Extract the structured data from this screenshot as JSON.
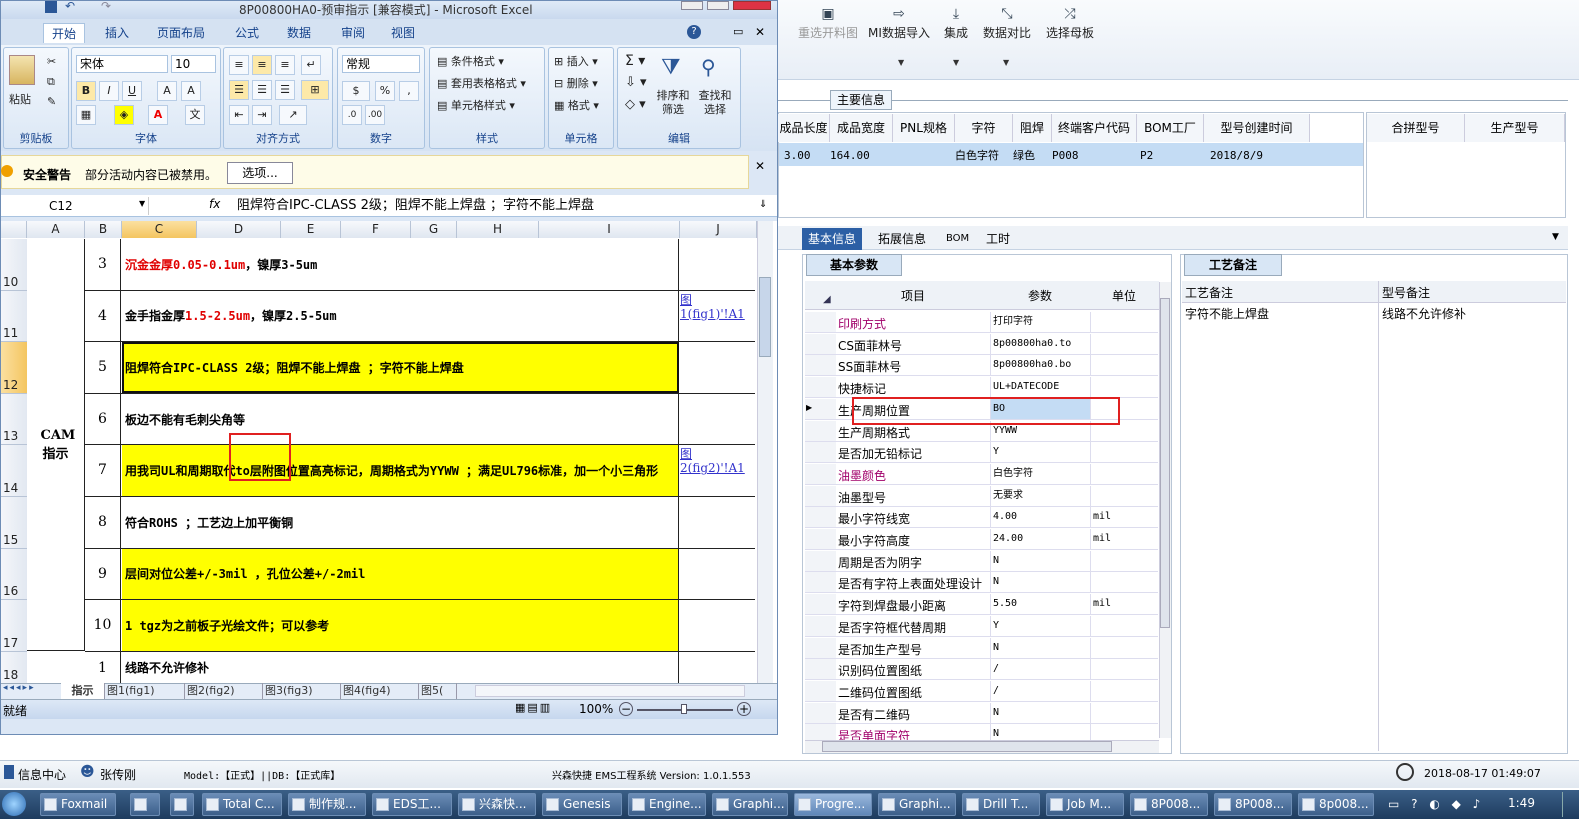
{
  "right_toolbar": [
    {
      "label": "重选开料图",
      "icon": "image-icon"
    },
    {
      "label": "MI数据导入",
      "icon": "import-icon"
    },
    {
      "label": "集成",
      "icon": "download-icon"
    },
    {
      "label": "数据对比",
      "icon": "compare-icon"
    },
    {
      "label": "选择母板",
      "icon": "shuffle-icon"
    }
  ],
  "main_info_tab": "主要信息",
  "grid": {
    "headers": [
      "成品长度",
      "成品宽度",
      "PNL规格",
      "字符",
      "阻焊",
      "终端客户代码",
      "BOM工厂",
      "型号创建时间"
    ],
    "row": [
      "3.00",
      "164.00",
      "",
      "白色字符",
      "绿色",
      "P008",
      "P2",
      "2018/8/9"
    ]
  },
  "merge": {
    "headers": [
      "合拼型号",
      "生产型号"
    ]
  },
  "detail_tabs": [
    "基本信息",
    "拓展信息",
    "BOM",
    "工时"
  ],
  "basic_params_tab": "基本参数",
  "process_tab": "工艺备注",
  "pg_headers": [
    "项目",
    "参数",
    "单位"
  ],
  "pg_rows": [
    {
      "k": "印刷方式",
      "v": "打印字符",
      "u": "",
      "kc": "#a0006a"
    },
    {
      "k": "CS面菲林号",
      "v": "8p00800ha0.to",
      "u": ""
    },
    {
      "k": "SS面菲林号",
      "v": "8p00800ha0.bo",
      "u": ""
    },
    {
      "k": "快捷标记",
      "v": "UL+DATECODE",
      "u": ""
    },
    {
      "k": "生产周期位置",
      "v": "BO",
      "u": ""
    },
    {
      "k": "生产周期格式",
      "v": "YYWW",
      "u": ""
    },
    {
      "k": "是否加无铅标记",
      "v": "Y",
      "u": ""
    },
    {
      "k": "油墨颜色",
      "v": "白色字符",
      "u": "",
      "kc": "#a0006a"
    },
    {
      "k": "油墨型号",
      "v": "无要求",
      "u": ""
    },
    {
      "k": "最小字符线宽",
      "v": "4.00",
      "u": "mil"
    },
    {
      "k": "最小字符高度",
      "v": "24.00",
      "u": "mil"
    },
    {
      "k": "周期是否为阴字",
      "v": "N",
      "u": ""
    },
    {
      "k": "是否有字符上表面处理设计",
      "v": "N",
      "u": ""
    },
    {
      "k": "字符到焊盘最小距离",
      "v": "5.50",
      "u": "mil"
    },
    {
      "k": "是否字符框代替周期",
      "v": "Y",
      "u": ""
    },
    {
      "k": "是否加生产型号",
      "v": "N",
      "u": ""
    },
    {
      "k": "识别码位置图纸",
      "v": "/",
      "u": ""
    },
    {
      "k": "二维码位置图纸",
      "v": "/",
      "u": ""
    },
    {
      "k": "是否有二维码",
      "v": "N",
      "u": ""
    },
    {
      "k": "是否单面字符",
      "v": "N",
      "u": "",
      "kc": "#a0006a"
    }
  ],
  "remark": {
    "h1": "工艺备注",
    "h2": "型号备注",
    "v1": "字符不能上焊盘",
    "v2": "线路不允许修补"
  },
  "status": {
    "info": "信息中心",
    "user": "张传刚",
    "model": "Model:【正式】||DB:【正式库】",
    "system": "兴森快捷 EMS工程系统 Version: 1.0.1.553",
    "datetime": "2018-08-17 01:49:07"
  },
  "excel": {
    "title": "8P00800HA0-预审指示 [兼容模式] - Microsoft Excel",
    "tabs": [
      "开始",
      "插入",
      "页面布局",
      "公式",
      "数据",
      "审阅",
      "视图"
    ],
    "font_name": "宋体",
    "font_size": "10",
    "number_format": "常规",
    "groups": [
      "剪贴板",
      "字体",
      "对齐方式",
      "数字",
      "样式",
      "单元格",
      "编辑"
    ],
    "paste": "粘贴",
    "style_btns": [
      "条件格式",
      "套用表格格式",
      "单元格样式"
    ],
    "cell_btns": [
      "插入",
      "删除",
      "格式"
    ],
    "edit_btns": [
      "排序和筛选",
      "查找和选择"
    ],
    "security_title": "安全警告",
    "security_text": "部分活动内容已被禁用。",
    "options_btn": "选项...",
    "name_box": "C12",
    "fx": "fx",
    "formula": "阻焊符合IPC-CLASS 2级；阻焊不能上焊盘 ；字符不能上焊盘",
    "cols": [
      "A",
      "B",
      "C",
      "D",
      "E",
      "F",
      "G",
      "H",
      "I",
      "J"
    ],
    "merged_a": "CAM指示",
    "rows": [
      {
        "rn": "10",
        "num": "3",
        "text": "沉金金厚0.05-0.1um，镍厚3-5um",
        "yellow": false,
        "j": ""
      },
      {
        "rn": "11",
        "num": "4",
        "text": "金手指金厚1.5-2.5um，镍厚2.5-5um",
        "yellow": false,
        "j": "图1(fig1)'!A1"
      },
      {
        "rn": "12",
        "num": "5",
        "text": "阻焊符合IPC-CLASS 2级；阻焊不能上焊盘 ；字符不能上焊盘",
        "yellow": true,
        "j": ""
      },
      {
        "rn": "13",
        "num": "6",
        "text": "板边不能有毛刺尖角等",
        "yellow": false,
        "j": ""
      },
      {
        "rn": "14",
        "num": "7",
        "text": "用我司UL和周期取代to层附图位置高亮标记，周期格式为YYWW ；满足UL796标准，加一个小三角形",
        "yellow": true,
        "j": "图2(fig2)'!A1"
      },
      {
        "rn": "15",
        "num": "8",
        "text": "符合ROHS ；工艺边上加平衡铜",
        "yellow": false,
        "j": ""
      },
      {
        "rn": "16",
        "num": "9",
        "text": "层间对位公差+/-3mil ，孔位公差+/-2mil",
        "yellow": true,
        "j": ""
      },
      {
        "rn": "17",
        "num": "10",
        "text": "1 tgz为之前板子光绘文件；可以参考",
        "yellow": true,
        "j": ""
      },
      {
        "rn": "18",
        "num": "1",
        "text": "线路不允许修补",
        "yellow": false,
        "j": ""
      }
    ],
    "sheets": [
      "指示",
      "图1(fig1)",
      "图2(fig2)",
      "图3(fig3)",
      "图4(fig4)",
      "图5("
    ],
    "ready": "就绪",
    "zoom": "100%"
  },
  "taskbar": [
    "Foxmail",
    "",
    "",
    "Total C...",
    "制作规...",
    "EDS工...",
    "兴森快...",
    "Genesis",
    "Engine...",
    "Graphi...",
    "Progre...",
    "Graphi...",
    "Drill T...",
    "Job M...",
    "8P008...",
    "8P008...",
    "8p008..."
  ],
  "clock": "1:49"
}
